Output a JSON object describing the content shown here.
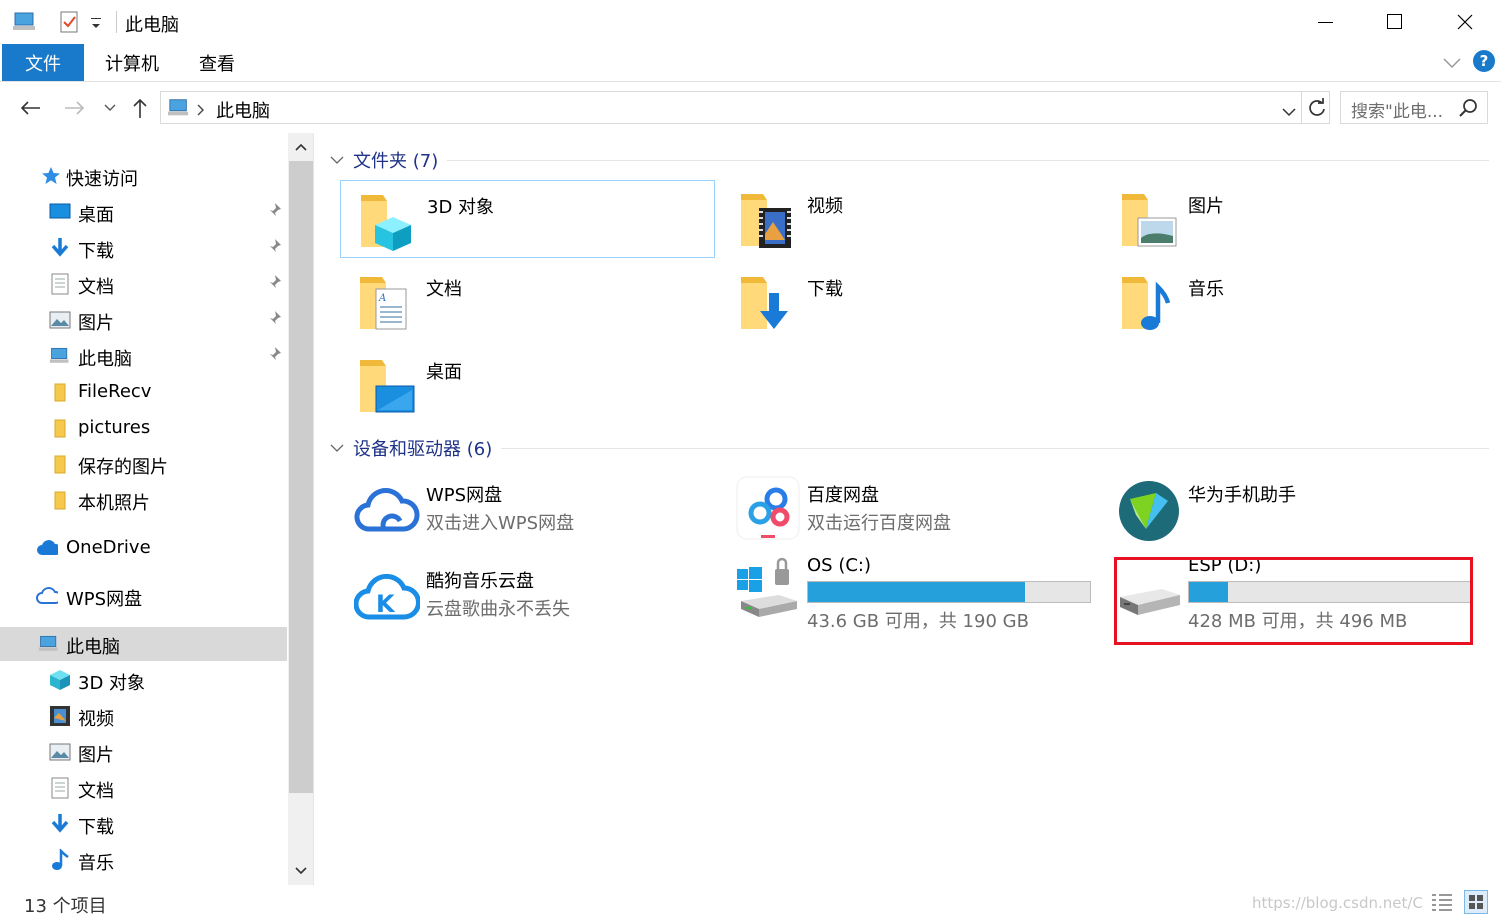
{
  "window": {
    "title": "此电脑"
  },
  "ribbon": {
    "tabs": [
      {
        "label": "文件"
      },
      {
        "label": "计算机"
      },
      {
        "label": "查看"
      }
    ],
    "help": "?"
  },
  "address": {
    "location": "此电脑",
    "search_placeholder": "搜索\"此电..."
  },
  "sidebar": {
    "items": [
      {
        "label": "快速访问",
        "icon": "star-icon"
      },
      {
        "label": "桌面",
        "icon": "desktop-icon"
      },
      {
        "label": "下载",
        "icon": "download-icon"
      },
      {
        "label": "文档",
        "icon": "document-icon"
      },
      {
        "label": "图片",
        "icon": "pictures-icon"
      },
      {
        "label": "此电脑",
        "icon": "computer-icon"
      },
      {
        "label": "FileRecv",
        "icon": "folder-icon"
      },
      {
        "label": "pictures",
        "icon": "folder-icon"
      },
      {
        "label": "保存的图片",
        "icon": "folder-icon"
      },
      {
        "label": "本机照片",
        "icon": "folder-icon"
      },
      {
        "label": "OneDrive",
        "icon": "cloud-icon"
      },
      {
        "label": "WPS网盘",
        "icon": "cloud-outline-icon"
      },
      {
        "label": "此电脑",
        "icon": "computer-icon"
      },
      {
        "label": "3D 对象",
        "icon": "cube-icon"
      },
      {
        "label": "视频",
        "icon": "video-icon"
      },
      {
        "label": "图片",
        "icon": "pictures-icon"
      },
      {
        "label": "文档",
        "icon": "document-icon"
      },
      {
        "label": "下载",
        "icon": "download-icon"
      },
      {
        "label": "音乐",
        "icon": "music-icon"
      }
    ]
  },
  "content": {
    "folders_header": "文件夹 (7)",
    "folders": [
      {
        "name": "3D 对象"
      },
      {
        "name": "视频"
      },
      {
        "name": "图片"
      },
      {
        "name": "文档"
      },
      {
        "name": "下载"
      },
      {
        "name": "音乐"
      },
      {
        "name": "桌面"
      }
    ],
    "devices_header": "设备和驱动器 (6)",
    "devices": [
      {
        "name": "WPS网盘",
        "subtitle": "双击进入WPS网盘"
      },
      {
        "name": "百度网盘",
        "subtitle": "双击运行百度网盘"
      },
      {
        "name": "华为手机助手"
      },
      {
        "name": "酷狗音乐云盘",
        "subtitle": "云盘歌曲永不丢失"
      },
      {
        "name": "OS (C:)",
        "free": "43.6 GB 可用，共 190 GB",
        "used_fraction": 0.771
      },
      {
        "name": "ESP (D:)",
        "free": "428 MB 可用，共 496 MB",
        "used_fraction": 0.137
      }
    ]
  },
  "status": {
    "item_count": "13 个项目",
    "watermark": "https://blog.csdn.net/Cath"
  },
  "colors": {
    "accent": "#1979ca",
    "drive_fill": "#26a0da",
    "highlight_box": "#e81123",
    "group_header": "#1e3287"
  }
}
